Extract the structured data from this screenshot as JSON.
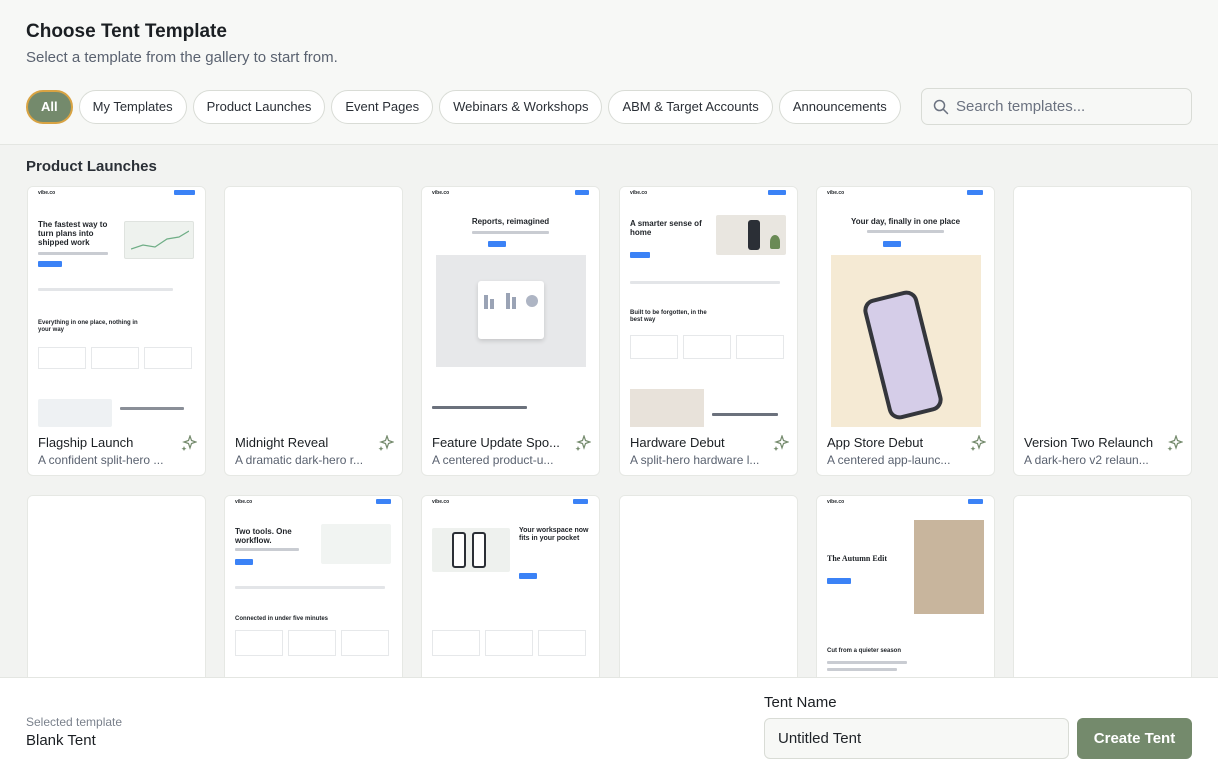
{
  "header": {
    "title": "Choose Tent Template",
    "subtitle": "Select a template from the gallery to start from."
  },
  "filters": [
    {
      "label": "All",
      "active": true
    },
    {
      "label": "My Templates",
      "active": false
    },
    {
      "label": "Product Launches",
      "active": false
    },
    {
      "label": "Event Pages",
      "active": false
    },
    {
      "label": "Webinars & Workshops",
      "active": false
    },
    {
      "label": "ABM & Target Accounts",
      "active": false
    },
    {
      "label": "Announcements",
      "active": false
    }
  ],
  "search": {
    "placeholder": "Search templates..."
  },
  "section": {
    "title": "Product Launches"
  },
  "templates": [
    {
      "name": "Flagship Launch",
      "desc": "A confident split-hero ..."
    },
    {
      "name": "Midnight Reveal",
      "desc": "A dramatic dark-hero r..."
    },
    {
      "name": "Feature Update Spo...",
      "desc": "A centered product-u..."
    },
    {
      "name": "Hardware Debut",
      "desc": "A split-hero hardware l..."
    },
    {
      "name": "App Store Debut",
      "desc": "A centered app-launc..."
    },
    {
      "name": "Version Two Relaunch",
      "desc": "A dark-hero v2 relaun..."
    }
  ],
  "thumb_text": {
    "brand": "vibe.co",
    "t1_headline": "The fastest way to turn plans into shipped work",
    "t1_section": "Everything in one place, nothing in your way",
    "t3_headline": "Reports, reimagined",
    "t4_headline": "A smarter sense of home",
    "t4_section": "Built to be forgotten, in the best way",
    "t5_headline": "Your day, finally in one place",
    "r2_t2_headline": "Two tools. One workflow.",
    "r2_t2_section": "Connected in under five minutes",
    "r2_t3_headline": "Your workspace now fits in your pocket",
    "r2_t5_headline": "The Autumn Edit",
    "r2_t5_section": "Cut from a quieter season"
  },
  "footer": {
    "selected_label": "Selected template",
    "selected_value": "Blank Tent",
    "tent_name_label": "Tent Name",
    "tent_name_value": "Untitled Tent",
    "create_label": "Create Tent"
  },
  "colors": {
    "accent": "#748a6c",
    "active_ring": "#d8a343",
    "link_blue": "#3b82f6"
  },
  "icons": {
    "search": "search-icon",
    "sparkle": "sparkle-icon"
  }
}
